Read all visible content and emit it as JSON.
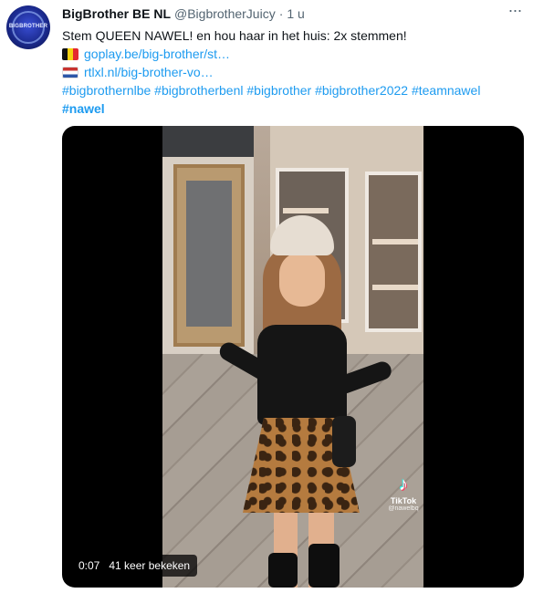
{
  "author": {
    "display_name": "BigBrother BE NL",
    "handle": "@BigbrotherJuicy",
    "separator": "·",
    "time": "1 u",
    "avatar_text": "BIGBROTHER"
  },
  "more_icon": "more-horizontal-icon",
  "tweet": {
    "line1": "Stem QUEEN NAWEL!  en hou haar in het huis: 2x stemmen!",
    "link_be": "goplay.be/big-brother/st…",
    "link_nl": "rtlxl.nl/big-brother-vo…",
    "hashtags_line": "#bigbrothernlbe #bigbrotherbenl #bigbrother #bigbrother2022 #teamnawel",
    "hashtag_last": "#nawel"
  },
  "video": {
    "timestamp": "0:07",
    "views": "41 keer bekeken",
    "watermark_label": "TikTok",
    "watermark_user": "@nawelbq",
    "watermark_icon": "tiktok-logo-icon"
  },
  "colors": {
    "link": "#1d9bf0",
    "text": "#0f1419",
    "muted": "#536471"
  }
}
